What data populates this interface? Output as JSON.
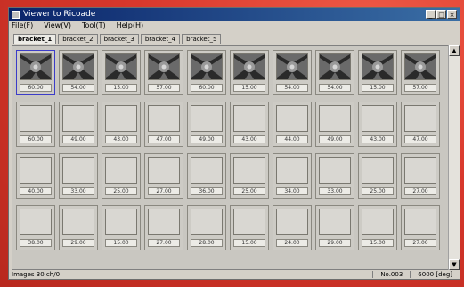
{
  "window": {
    "title": "Viewer to Ricoade",
    "controls": [
      "_",
      "□",
      "×"
    ]
  },
  "menu": [
    "File(F)",
    "View(V)",
    "Tool(T)",
    "Help(H)"
  ],
  "tabs": [
    "bracket_1",
    "bracket_2",
    "bracket_3",
    "bracket_4",
    "bracket_5"
  ],
  "active_tab": 0,
  "grid": {
    "rows": [
      {
        "type": "image",
        "values": [
          "60.00",
          "54.00",
          "15.00",
          "57.00",
          "60.00",
          "15.00",
          "54.00",
          "54.00",
          "15.00",
          "57.00"
        ]
      },
      {
        "type": "blank",
        "values": [
          "60.00",
          "49.00",
          "43.00",
          "47.00",
          "49.00",
          "43.00",
          "44.00",
          "49.00",
          "43.00",
          "47.00"
        ]
      },
      {
        "type": "blank",
        "values": [
          "40.00",
          "33.00",
          "25.00",
          "27.00",
          "36.00",
          "25.00",
          "34.00",
          "33.00",
          "25.00",
          "27.00"
        ]
      },
      {
        "type": "blank",
        "values": [
          "38.00",
          "29.00",
          "15.00",
          "27.00",
          "28.00",
          "15.00",
          "24.00",
          "29.00",
          "15.00",
          "27.00"
        ]
      }
    ]
  },
  "status": {
    "left": "Images 30 ch/0",
    "middle": "No.003",
    "right": "6000 [deg]"
  },
  "icons": {
    "scroll_up": "scroll-up-arrow-icon",
    "scroll_down": "scroll-down-arrow-icon"
  }
}
